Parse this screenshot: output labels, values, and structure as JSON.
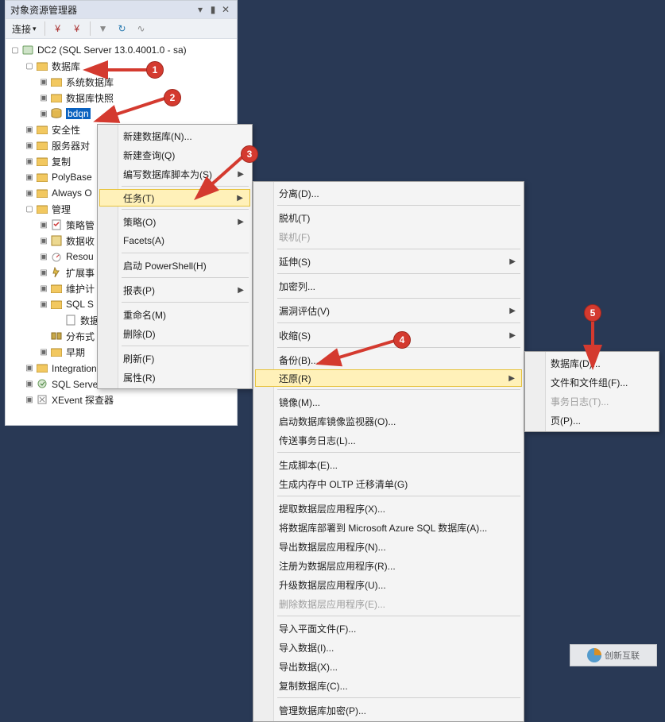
{
  "panel": {
    "title": "对象资源管理器",
    "toolbar": {
      "connect": "连接"
    }
  },
  "tree": {
    "root": "DC2 (SQL Server 13.0.4001.0 - sa)",
    "databases": "数据库",
    "sysdb": "系统数据库",
    "dbsnap": "数据库快照",
    "bdqn": "bdqn",
    "security": "安全性",
    "serverobj": "服务器对",
    "replication": "复制",
    "polybase": "PolyBase",
    "always": "Always O",
    "management": "管理",
    "policy": "策略管",
    "datacollect": "数据收",
    "resgov": "Resou",
    "extevents": "扩展事",
    "maint": "维护计",
    "sqlsrv": "SQL S",
    "dblvl": "数据库",
    "distrib": "分布式",
    "legacy": "早期",
    "iscatalog": "Integration Services 目录",
    "agent": "SQL Server 代理",
    "xevent": "XEvent 探查器"
  },
  "menu1": {
    "newdb": "新建数据库(N)...",
    "newquery": "新建查询(Q)",
    "script": "编写数据库脚本为(S)",
    "tasks": "任务(T)",
    "policies": "策略(O)",
    "facets": "Facets(A)",
    "powershell": "启动 PowerShell(H)",
    "reports": "报表(P)",
    "rename": "重命名(M)",
    "delete": "删除(D)",
    "refresh": "刷新(F)",
    "properties": "属性(R)"
  },
  "menu2": {
    "detach": "分离(D)...",
    "offline": "脱机(T)",
    "online": "联机(F)",
    "stretch": "延伸(S)",
    "encryptcol": "加密列...",
    "vuln": "漏洞评估(V)",
    "shrink": "收缩(S)",
    "backup": "备份(B)...",
    "restore": "还原(R)",
    "mirror": "镜像(M)...",
    "launchmirror": "启动数据库镜像监视器(O)...",
    "shiplog": "传送事务日志(L)...",
    "genscript": "生成脚本(E)...",
    "genoltp": "生成内存中 OLTP 迁移清单(G)",
    "extract": "提取数据层应用程序(X)...",
    "deployazure": "将数据库部署到 Microsoft Azure SQL 数据库(A)...",
    "exportdac": "导出数据层应用程序(N)...",
    "registerdac": "注册为数据层应用程序(R)...",
    "upgradedac": "升级数据层应用程序(U)...",
    "deletedac": "删除数据层应用程序(E)...",
    "importflat": "导入平面文件(F)...",
    "importdata": "导入数据(I)...",
    "exportdata": "导出数据(X)...",
    "copydb": "复制数据库(C)...",
    "managetde": "管理数据库加密(P)..."
  },
  "menu3": {
    "database": "数据库(D)...",
    "filegroup": "文件和文件组(F)...",
    "translog": "事务日志(T)...",
    "page": "页(P)..."
  },
  "watermark": {
    "text": "创新互联"
  }
}
